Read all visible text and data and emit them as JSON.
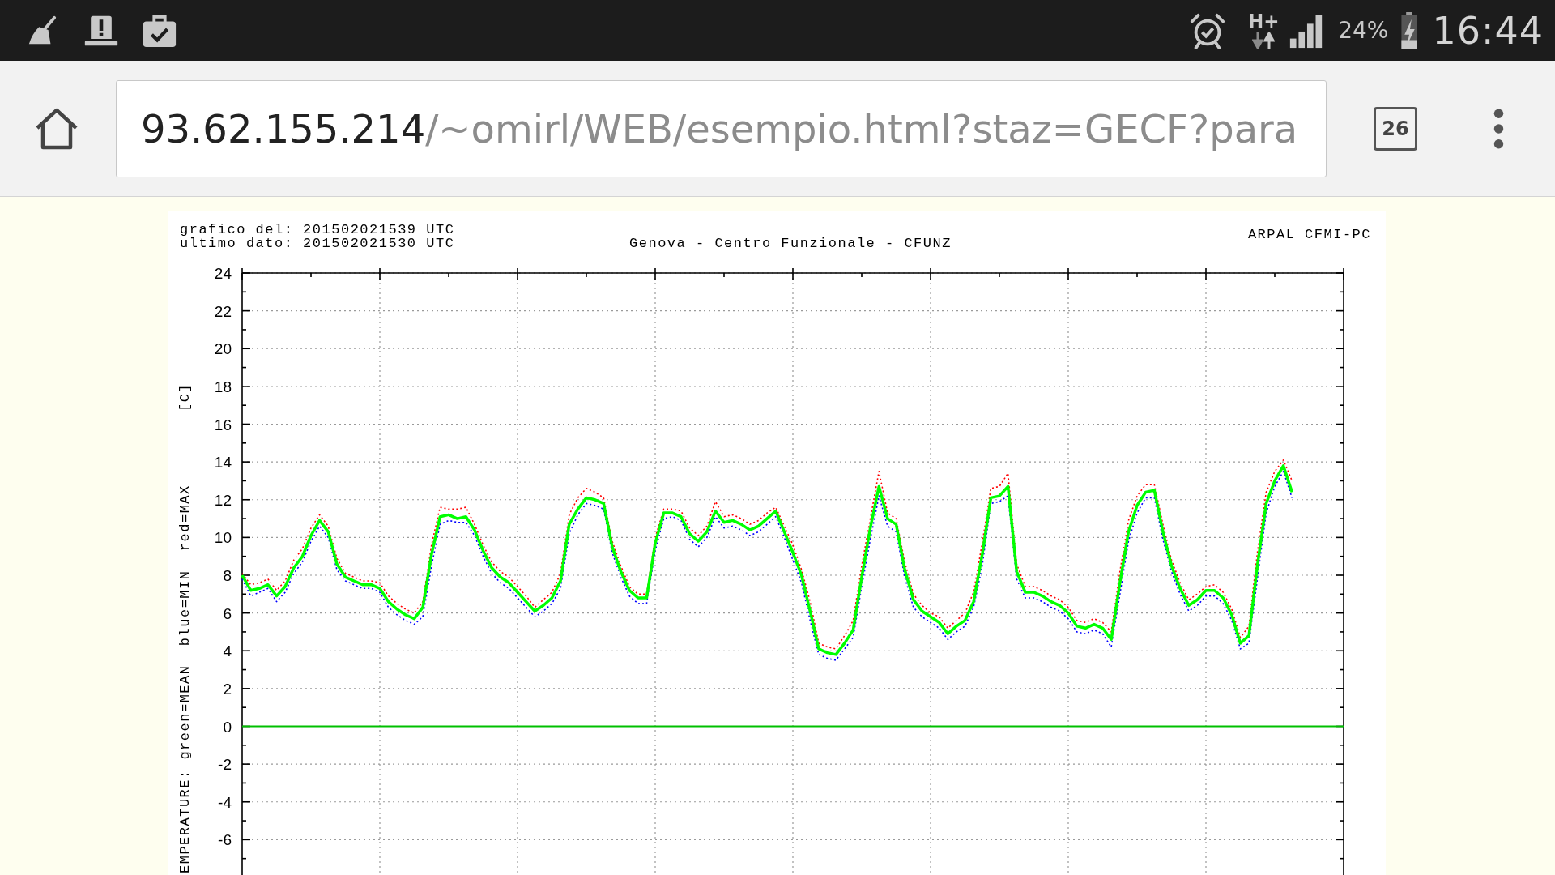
{
  "status_bar": {
    "network_type": "H+",
    "battery_percent": "24%",
    "time": "16:44"
  },
  "address_bar": {
    "url_host": "93.62.155.214",
    "url_path": "/~omirl/WEB/esempio.html?staz=GECF?para",
    "tab_count": "26"
  },
  "chart": {
    "info_lines": [
      "grafico del: 201502021539 UTC",
      "ultimo dato: 201502021530 UTC"
    ],
    "source": "ARPAL CFMI-PC",
    "unit_label": "[C]",
    "chart_data": {
      "type": "line",
      "title": "Genova - Centro Funzionale - CFUNZ",
      "ylabel": "EMPERATURE: green=MEAN  blue=MIN  red=MAX",
      "categories": [
        null,
        null,
        null,
        null,
        null,
        null,
        null,
        null,
        null,
        null,
        null,
        null,
        null,
        null,
        null,
        null,
        null,
        null,
        null,
        null,
        null,
        null,
        null,
        null,
        null,
        null,
        null,
        null,
        null,
        null,
        null,
        null,
        null,
        null,
        null,
        null,
        null,
        null,
        null,
        null,
        null,
        null,
        null,
        null,
        null,
        null,
        null,
        null,
        null,
        null,
        null,
        null,
        null,
        null,
        null,
        null,
        null,
        null,
        null,
        null,
        null,
        null,
        null,
        null,
        null,
        null,
        null,
        null,
        null,
        null,
        null,
        null,
        null,
        null,
        null,
        null,
        null,
        null,
        null,
        null,
        null,
        null,
        null,
        null,
        null,
        null,
        null,
        null,
        null,
        null,
        null,
        null,
        null,
        null,
        null,
        null,
        null,
        null,
        null,
        null,
        null,
        null,
        null,
        null,
        null,
        null,
        null,
        null,
        null,
        null,
        null,
        null,
        null,
        null,
        null,
        null,
        null,
        null,
        null,
        null,
        null,
        null,
        null,
        null,
        null,
        null,
        null,
        null,
        null
      ],
      "series": [
        {
          "color": "#00ff00",
          "line_style": "solid",
          "values": [
            8.0,
            7.2,
            7.3,
            7.5,
            6.9,
            7.4,
            8.4,
            9.0,
            10.1,
            10.9,
            10.3,
            8.6,
            7.9,
            7.7,
            7.5,
            7.5,
            7.3,
            6.6,
            6.2,
            5.9,
            5.7,
            6.3,
            9.1,
            11.1,
            11.2,
            11.0,
            11.1,
            10.4,
            9.3,
            8.4,
            7.9,
            7.6,
            7.1,
            6.6,
            6.1,
            6.4,
            6.8,
            7.7,
            10.7,
            11.5,
            12.1,
            12.0,
            11.8,
            9.5,
            8.2,
            7.2,
            6.8,
            6.8,
            9.7,
            11.3,
            11.3,
            11.1,
            10.2,
            9.8,
            10.3,
            11.4,
            10.8,
            10.9,
            10.7,
            10.4,
            10.6,
            11.0,
            11.4,
            10.3,
            9.2,
            8.0,
            6.1,
            4.1,
            3.9,
            3.8,
            4.4,
            5.1,
            7.9,
            10.5,
            12.7,
            11.0,
            10.7,
            8.3,
            6.7,
            6.1,
            5.8,
            5.5,
            4.9,
            5.3,
            5.6,
            6.6,
            9.1,
            12.1,
            12.2,
            12.7,
            8.2,
            7.1,
            7.1,
            6.9,
            6.6,
            6.4,
            6.0,
            5.3,
            5.2,
            5.4,
            5.2,
            4.6,
            7.6,
            10.3,
            11.7,
            12.4,
            12.5,
            10.3,
            8.5,
            7.3,
            6.4,
            6.7,
            7.2,
            7.2,
            6.8,
            5.9,
            4.4,
            4.8,
            8.6,
            11.8,
            13.0,
            13.8,
            12.4,
            null,
            null,
            null,
            null,
            null,
            null
          ]
        },
        {
          "color": "#0000ff",
          "line_style": "dotted",
          "values": [
            7.8,
            6.9,
            7.1,
            7.3,
            6.6,
            7.1,
            8.1,
            8.7,
            9.8,
            10.6,
            10.0,
            8.3,
            7.7,
            7.5,
            7.3,
            7.3,
            7.1,
            6.3,
            5.9,
            5.6,
            5.4,
            5.8,
            8.5,
            10.7,
            10.9,
            10.8,
            10.8,
            10.1,
            9.0,
            8.1,
            7.6,
            7.3,
            6.8,
            6.3,
            5.8,
            6.1,
            6.5,
            7.3,
            10.2,
            11.2,
            11.8,
            11.7,
            11.5,
            9.2,
            7.9,
            6.9,
            6.5,
            6.5,
            9.3,
            11.0,
            11.1,
            10.9,
            9.9,
            9.5,
            10.0,
            11.1,
            10.5,
            10.6,
            10.4,
            10.1,
            10.3,
            10.7,
            11.1,
            10.0,
            8.8,
            7.6,
            5.6,
            3.8,
            3.6,
            3.5,
            4.1,
            4.7,
            7.4,
            9.9,
            12.2,
            10.6,
            10.3,
            7.9,
            6.3,
            5.8,
            5.5,
            5.2,
            4.6,
            5.0,
            5.3,
            6.3,
            8.5,
            11.8,
            11.9,
            12.2,
            7.8,
            6.8,
            6.8,
            6.6,
            6.3,
            6.1,
            5.7,
            5.0,
            4.9,
            5.1,
            4.9,
            4.2,
            7.0,
            9.8,
            11.3,
            12.1,
            12.1,
            9.9,
            8.2,
            7.0,
            6.1,
            6.4,
            6.9,
            6.9,
            6.5,
            5.6,
            4.1,
            4.4,
            7.9,
            11.3,
            12.7,
            13.5,
            12.1,
            null,
            null,
            null,
            null,
            null,
            null
          ]
        },
        {
          "color": "#ff0000",
          "line_style": "dotted",
          "values": [
            8.1,
            7.5,
            7.6,
            7.8,
            7.2,
            7.7,
            8.8,
            9.4,
            10.5,
            11.2,
            10.6,
            8.9,
            8.1,
            7.9,
            7.7,
            7.7,
            7.6,
            6.9,
            6.5,
            6.2,
            6.0,
            6.6,
            9.6,
            11.6,
            11.5,
            11.5,
            11.6,
            10.7,
            9.6,
            8.7,
            8.2,
            7.9,
            7.4,
            6.9,
            6.3,
            6.7,
            7.1,
            8.1,
            11.2,
            12.1,
            12.6,
            12.4,
            12.1,
            9.8,
            8.5,
            7.4,
            7.0,
            7.0,
            10.0,
            11.5,
            11.5,
            11.4,
            10.5,
            10.1,
            10.6,
            11.9,
            11.1,
            11.2,
            11.0,
            10.7,
            10.9,
            11.3,
            11.6,
            10.6,
            9.6,
            8.3,
            6.6,
            4.4,
            4.2,
            4.1,
            4.8,
            5.6,
            8.5,
            11.0,
            13.5,
            11.3,
            11.0,
            8.7,
            7.0,
            6.4,
            6.0,
            5.8,
            5.2,
            5.6,
            6.0,
            7.1,
            9.7,
            12.6,
            12.7,
            13.4,
            8.6,
            7.4,
            7.4,
            7.2,
            6.9,
            6.7,
            6.3,
            5.6,
            5.5,
            5.7,
            5.5,
            5.0,
            8.2,
            10.9,
            12.2,
            12.8,
            12.8,
            10.7,
            8.8,
            7.6,
            6.7,
            7.0,
            7.4,
            7.5,
            7.1,
            6.2,
            4.7,
            5.3,
            9.3,
            12.4,
            13.5,
            14.1,
            13.0,
            null,
            null,
            null,
            null,
            null,
            null
          ]
        }
      ],
      "ylim": [
        -8,
        24
      ],
      "yticks": [
        24,
        22,
        20,
        18,
        16,
        14,
        12,
        10,
        8,
        6,
        4,
        2,
        0,
        -2,
        -4,
        -6
      ],
      "grid": true,
      "ref_lines": [
        {
          "axis": "y",
          "value": 0,
          "color": "#00c000"
        }
      ]
    }
  }
}
